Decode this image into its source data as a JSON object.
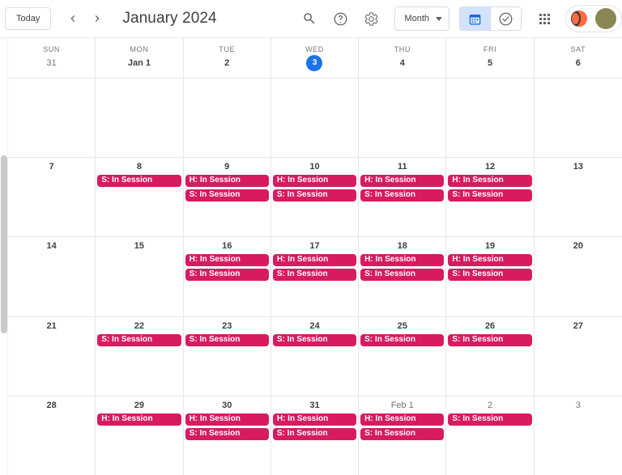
{
  "toolbar": {
    "today_label": "Today",
    "prev_icon": "chevron-left-icon",
    "next_icon": "chevron-right-icon",
    "month_title": "January 2024",
    "search_icon": "search-icon",
    "help_icon": "help-icon",
    "settings_icon": "gear-icon",
    "view_select_label": "Month",
    "calendar_toggle_icon": "calendar-icon",
    "tasks_toggle_icon": "tasks-check-icon",
    "apps_icon": "apps-grid-icon",
    "opera_icon": "opera-browser-icon",
    "avatar_icon": "user-avatar"
  },
  "colors": {
    "today_blue": "#1a73e8",
    "event_pink": "#d81b60",
    "toggle_active_bg": "#d3e3fd",
    "grid_line": "#e4e6e8"
  },
  "day_headers": [
    {
      "name": "SUN",
      "num": "31",
      "muted": true,
      "today": false
    },
    {
      "name": "MON",
      "num": "Jan 1",
      "muted": false,
      "today": false
    },
    {
      "name": "TUE",
      "num": "2",
      "muted": false,
      "today": false
    },
    {
      "name": "WED",
      "num": "3",
      "muted": false,
      "today": true
    },
    {
      "name": "THU",
      "num": "4",
      "muted": false,
      "today": false
    },
    {
      "name": "FRI",
      "num": "5",
      "muted": false,
      "today": false
    },
    {
      "name": "SAT",
      "num": "6",
      "muted": false,
      "today": false
    }
  ],
  "weeks": [
    [
      {
        "num": "",
        "muted": false,
        "events": []
      },
      {
        "num": "",
        "muted": false,
        "events": []
      },
      {
        "num": "",
        "muted": false,
        "events": []
      },
      {
        "num": "",
        "muted": false,
        "events": []
      },
      {
        "num": "",
        "muted": false,
        "events": []
      },
      {
        "num": "",
        "muted": false,
        "events": []
      },
      {
        "num": "",
        "muted": false,
        "events": []
      }
    ],
    [
      {
        "num": "7",
        "muted": false,
        "events": []
      },
      {
        "num": "8",
        "muted": false,
        "events": [
          "S: In Session"
        ]
      },
      {
        "num": "9",
        "muted": false,
        "events": [
          "H: In Session",
          "S: In Session"
        ]
      },
      {
        "num": "10",
        "muted": false,
        "events": [
          "H: In Session",
          "S: In Session"
        ]
      },
      {
        "num": "11",
        "muted": false,
        "events": [
          "H: In Session",
          "S: In Session"
        ]
      },
      {
        "num": "12",
        "muted": false,
        "events": [
          "H: In Session",
          "S: In Session"
        ]
      },
      {
        "num": "13",
        "muted": false,
        "events": []
      }
    ],
    [
      {
        "num": "14",
        "muted": false,
        "events": []
      },
      {
        "num": "15",
        "muted": false,
        "events": []
      },
      {
        "num": "16",
        "muted": false,
        "events": [
          "H: In Session",
          "S: In Session"
        ]
      },
      {
        "num": "17",
        "muted": false,
        "events": [
          "H: In Session",
          "S: In Session"
        ]
      },
      {
        "num": "18",
        "muted": false,
        "events": [
          "H: In Session",
          "S: In Session"
        ]
      },
      {
        "num": "19",
        "muted": false,
        "events": [
          "H: In Session",
          "S: In Session"
        ]
      },
      {
        "num": "20",
        "muted": false,
        "events": []
      }
    ],
    [
      {
        "num": "21",
        "muted": false,
        "events": []
      },
      {
        "num": "22",
        "muted": false,
        "events": [
          "S: In Session"
        ]
      },
      {
        "num": "23",
        "muted": false,
        "events": [
          "S: In Session"
        ]
      },
      {
        "num": "24",
        "muted": false,
        "events": [
          "S: In Session"
        ]
      },
      {
        "num": "25",
        "muted": false,
        "events": [
          "S: In Session"
        ]
      },
      {
        "num": "26",
        "muted": false,
        "events": [
          "S: In Session"
        ]
      },
      {
        "num": "27",
        "muted": false,
        "events": []
      }
    ],
    [
      {
        "num": "28",
        "muted": false,
        "events": []
      },
      {
        "num": "29",
        "muted": false,
        "events": [
          "H: In Session"
        ]
      },
      {
        "num": "30",
        "muted": false,
        "events": [
          "H: In Session",
          "S: In Session"
        ]
      },
      {
        "num": "31",
        "muted": false,
        "events": [
          "H: In Session",
          "S: In Session"
        ]
      },
      {
        "num": "Feb 1",
        "muted": true,
        "events": [
          "H: In Session",
          "S: In Session"
        ]
      },
      {
        "num": "2",
        "muted": true,
        "events": [
          "S: In Session"
        ]
      },
      {
        "num": "3",
        "muted": true,
        "events": []
      }
    ]
  ]
}
